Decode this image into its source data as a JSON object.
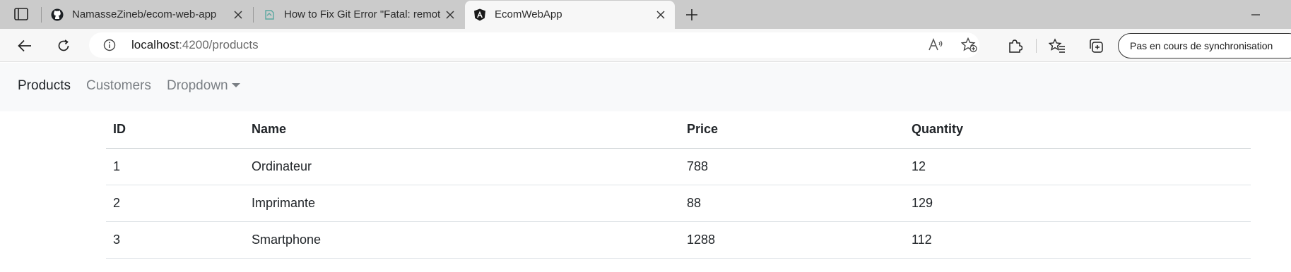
{
  "browser": {
    "tabs": [
      {
        "title": "NamasseZineb/ecom-web-app",
        "favicon": "github-icon",
        "active": false
      },
      {
        "title": "How to Fix Git Error \"Fatal: remote",
        "favicon": "article-icon",
        "active": false
      },
      {
        "title": "EcomWebApp",
        "favicon": "angular-icon",
        "active": true
      }
    ],
    "url_host": "localhost",
    "url_path": ":4200/products",
    "sync_label": "Pas en cours de synchronisation"
  },
  "navbar": {
    "links": [
      {
        "label": "Products",
        "active": true
      },
      {
        "label": "Customers",
        "active": false
      },
      {
        "label": "Dropdown",
        "active": false
      }
    ]
  },
  "table": {
    "headers": [
      "ID",
      "Name",
      "Price",
      "Quantity"
    ],
    "rows": [
      [
        "1",
        "Ordinateur",
        "788",
        "12"
      ],
      [
        "2",
        "Imprimante",
        "88",
        "129"
      ],
      [
        "3",
        "Smartphone",
        "1288",
        "112"
      ]
    ]
  }
}
